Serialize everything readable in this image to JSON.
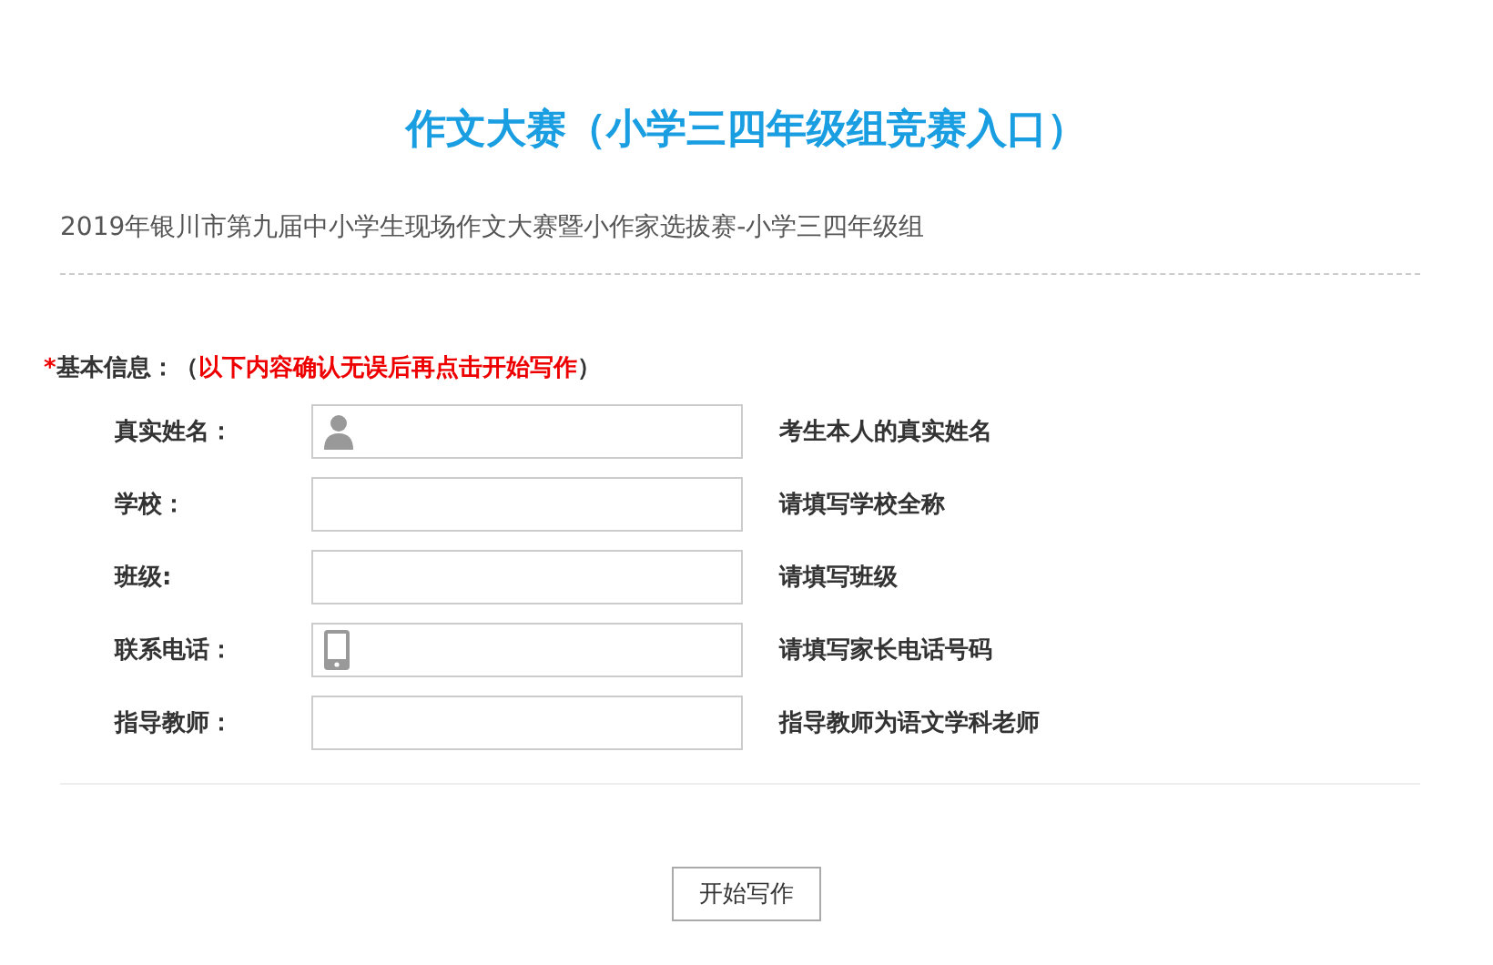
{
  "title": "作文大赛（小学三四年级组竞赛入口）",
  "subtitle": "2019年银川市第九届中小学生现场作文大赛暨小作家选拔赛-小学三四年级组",
  "section": {
    "required_mark": "*",
    "label": "基本信息：（",
    "notice": "以下内容确认无误后再点击开始写作",
    "close": "）"
  },
  "fields": [
    {
      "label": "真实姓名：",
      "kind": "name",
      "hint": "考生本人的真实姓名"
    },
    {
      "label": "学校：",
      "kind": "text",
      "hint": "请填写学校全称"
    },
    {
      "label": "班级:",
      "kind": "text",
      "hint": "请填写班级"
    },
    {
      "label": "联系电话：",
      "kind": "phone",
      "hint": "请填写家长电话号码"
    },
    {
      "label": "指导教师：",
      "kind": "text",
      "hint": "指导教师为语文学科老师"
    }
  ],
  "submit": "开始写作"
}
